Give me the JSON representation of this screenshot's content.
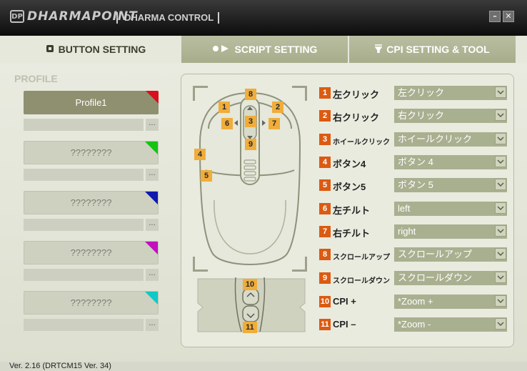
{
  "titlebar": {
    "brand_mark": "DP",
    "brand": "DHARMAPOINT",
    "app_title": "DHARMA CONTROL",
    "minimize_label": "–",
    "close_label": "✕"
  },
  "tabs": [
    {
      "label": "BUTTON SETTING",
      "active": true,
      "icon": "square-dot-icon"
    },
    {
      "label": "SCRIPT SETTING",
      "active": false,
      "icon": "play-dot-icon"
    },
    {
      "label": "CPI SETTING & TOOL",
      "active": false,
      "icon": "filter-icon"
    }
  ],
  "profiles": {
    "heading": "PROFILE",
    "items": [
      {
        "name": "Profile1",
        "selected": true,
        "color": "#d8101e",
        "field_value": "",
        "dots": "..."
      },
      {
        "name": "????????",
        "selected": false,
        "color": "#14c414",
        "field_value": "",
        "dots": "..."
      },
      {
        "name": "????????",
        "selected": false,
        "color": "#0f18b0",
        "field_value": "",
        "dots": "..."
      },
      {
        "name": "????????",
        "selected": false,
        "color": "#c010c0",
        "field_value": "",
        "dots": "..."
      },
      {
        "name": "????????",
        "selected": false,
        "color": "#10c8c8",
        "field_value": "",
        "dots": "..."
      }
    ]
  },
  "mouse_labels": [
    "1",
    "2",
    "3",
    "4",
    "5",
    "6",
    "7",
    "8",
    "9",
    "10",
    "11"
  ],
  "button_rows": [
    {
      "num": "1",
      "name": "左クリック",
      "value": "左クリック"
    },
    {
      "num": "2",
      "name": "右クリック",
      "value": "右クリック"
    },
    {
      "num": "3",
      "name": "ホイールクリック",
      "value": "ホイールクリック",
      "small": true
    },
    {
      "num": "4",
      "name": "ボタン4",
      "value": "ボタン 4"
    },
    {
      "num": "5",
      "name": "ボタン5",
      "value": "ボタン 5"
    },
    {
      "num": "6",
      "name": "左チルト",
      "value": "left"
    },
    {
      "num": "7",
      "name": "右チルト",
      "value": "right"
    },
    {
      "num": "8",
      "name": "スクロールアップ",
      "value": "スクロールアップ",
      "small": true
    },
    {
      "num": "9",
      "name": "スクロールダウン",
      "value": "スクロールダウン",
      "small": true
    },
    {
      "num": "10",
      "name": "CPI +",
      "value": "*Zoom +"
    },
    {
      "num": "11",
      "name": "CPI –",
      "value": "*Zoom -"
    }
  ],
  "footer": {
    "version": "Ver.  2.16   (DRTCM15 Ver. 34)"
  },
  "colors": {
    "accent_number": "#dc5a12",
    "mouse_number": "#f0ad3a",
    "dropdown": "#a9b090",
    "selected_profile": "#8e9070"
  }
}
